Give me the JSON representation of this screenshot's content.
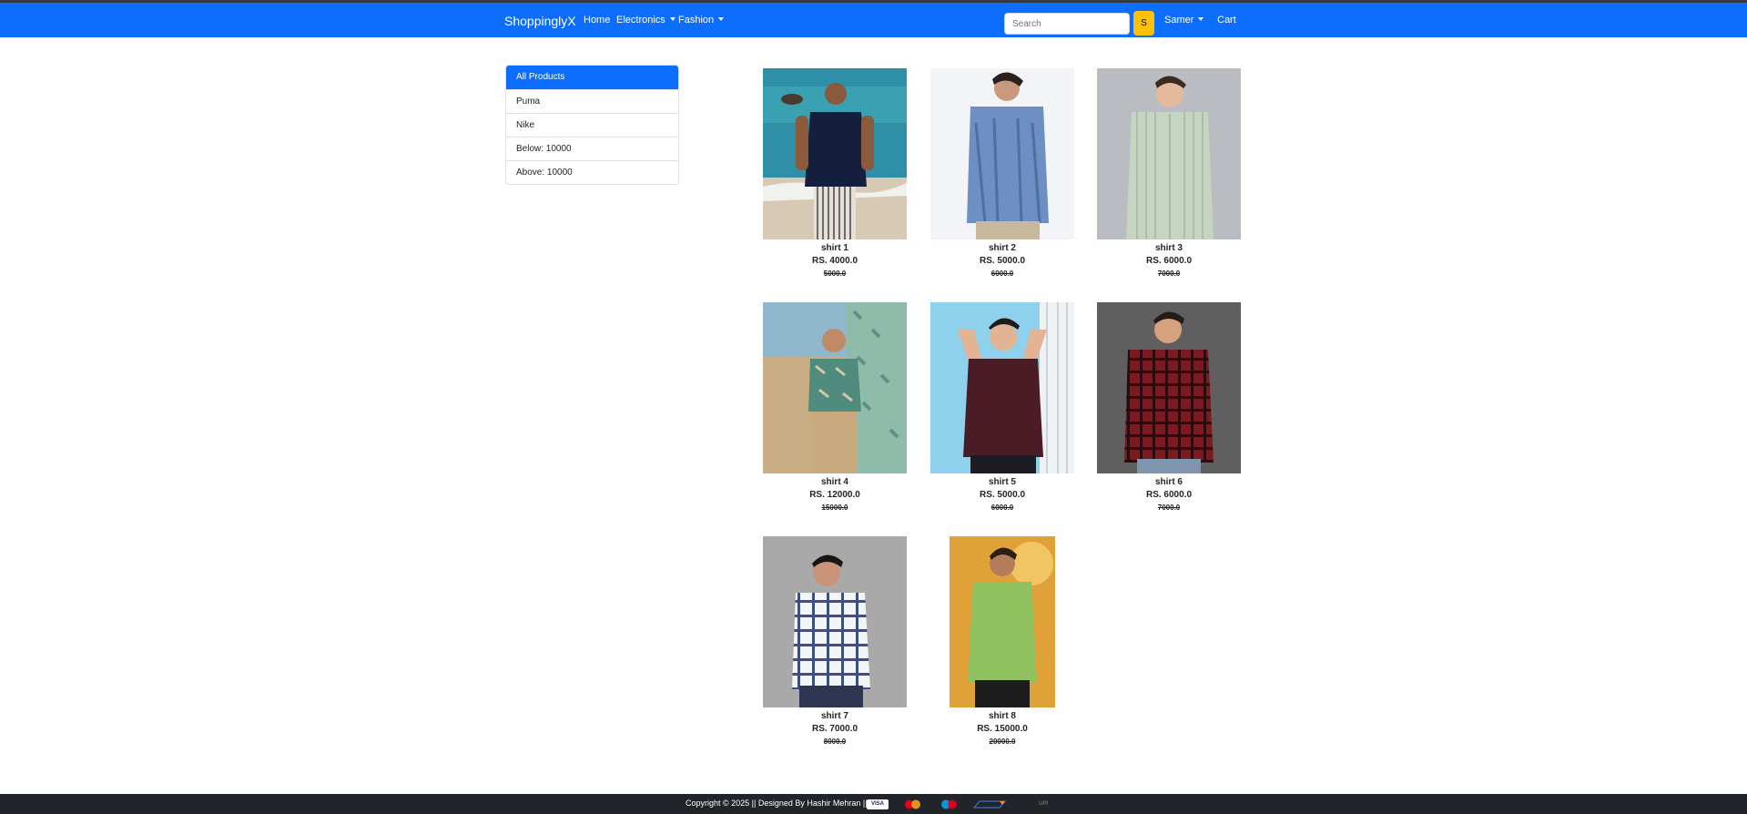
{
  "navbar": {
    "brand": "ShoppinglyX",
    "home": "Home",
    "electronics": "Electronics",
    "fashion": "Fashion",
    "search_placeholder": "Search",
    "search_button": "S",
    "user": "Samer",
    "cart": "Cart"
  },
  "filters": [
    {
      "label": "All Products",
      "active": true
    },
    {
      "label": "Puma",
      "active": false
    },
    {
      "label": "Nike",
      "active": false
    },
    {
      "label": "Below: 10000",
      "active": false
    },
    {
      "label": "Above: 10000",
      "active": false
    }
  ],
  "products": [
    {
      "name": "shirt 1",
      "price": "RS. 4000.0",
      "mrp": "5000.0"
    },
    {
      "name": "shirt 2",
      "price": "RS. 5000.0",
      "mrp": "6000.0"
    },
    {
      "name": "shirt 3",
      "price": "RS. 6000.0",
      "mrp": "7000.0"
    },
    {
      "name": "shirt 4",
      "price": "RS. 12000.0",
      "mrp": "15000.0"
    },
    {
      "name": "shirt 5",
      "price": "RS. 5000.0",
      "mrp": "6000.0"
    },
    {
      "name": "shirt 6",
      "price": "RS. 6000.0",
      "mrp": "7000.0"
    },
    {
      "name": "shirt 7",
      "price": "RS. 7000.0",
      "mrp": "8000.0"
    },
    {
      "name": "shirt 8",
      "price": "RS. 15000.0",
      "mrp": "20000.0"
    }
  ],
  "footer": {
    "text": "Copyright © 2025 || Designed By Hashir Mehran ||",
    "payment_icons": [
      "visa",
      "mastercard",
      "maestro",
      "rupay",
      "upi"
    ],
    "visa": "VISA",
    "upi": "UPI"
  },
  "colors": {
    "primary": "#0d6efd",
    "warning": "#ffc107",
    "footer_bg": "#212529"
  }
}
